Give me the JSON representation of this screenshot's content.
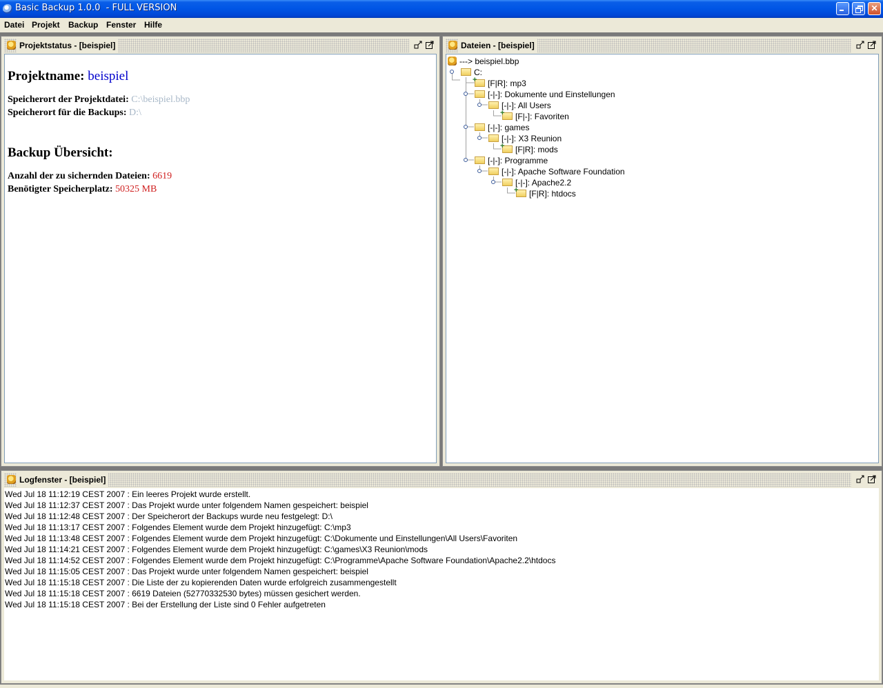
{
  "window": {
    "title": "Basic Backup 1.0.0  - FULL VERSION",
    "minimize_icon": "minimize-icon",
    "restore_icon": "restore-icon",
    "close_icon": "close-icon"
  },
  "menubar": {
    "items": [
      "Datei",
      "Projekt",
      "Backup",
      "Fenster",
      "Hilfe"
    ]
  },
  "status_panel": {
    "title": "Projektstatus - [beispiel]",
    "project_name_label": "Projektname:",
    "project_name_value": "beispiel",
    "file_location_label": "Speicherort der Projektdatei:",
    "file_location_value": "C:\\beispiel.bbp",
    "backup_location_label": "Speicherort für die Backups:",
    "backup_location_value": "D:\\",
    "overview_heading": "Backup Übersicht:",
    "file_count_label": "Anzahl der zu sichernden Dateien:",
    "file_count_value": "6619",
    "space_label": "Benötigter Speicherplatz:",
    "space_value": "50325 MB"
  },
  "files_panel": {
    "title": "Dateien - [beispiel]",
    "tree": [
      {
        "label": "---> beispiel.bbp"
      },
      {
        "label": "C:"
      },
      {
        "label": "[F|R]: mp3"
      },
      {
        "label": "[-|-]: Dokumente und Einstellungen"
      },
      {
        "label": "[-|-]: All Users"
      },
      {
        "label": "[F|-]: Favoriten"
      },
      {
        "label": "[-|-]: games"
      },
      {
        "label": "[-|-]: X3 Reunion"
      },
      {
        "label": "[F|R]: mods"
      },
      {
        "label": "[-|-]: Programme"
      },
      {
        "label": "[-|-]: Apache Software Foundation"
      },
      {
        "label": "[-|-]: Apache2.2"
      },
      {
        "label": "[F|R]: htdocs"
      }
    ]
  },
  "log_panel": {
    "title": "Logfenster - [beispiel]",
    "lines": [
      "Wed Jul 18 11:12:19 CEST 2007 : Ein leeres Projekt wurde erstellt.",
      "Wed Jul 18 11:12:37 CEST 2007 : Das Projekt wurde unter folgendem Namen gespeichert: beispiel",
      "Wed Jul 18 11:12:48 CEST 2007 : Der Speicherort der Backups wurde neu festgelegt: D:\\",
      "Wed Jul 18 11:13:17 CEST 2007 : Folgendes Element wurde dem Projekt hinzugefügt: C:\\mp3",
      "Wed Jul 18 11:13:48 CEST 2007 : Folgendes Element wurde dem Projekt hinzugefügt: C:\\Dokumente und Einstellungen\\All Users\\Favoriten",
      "Wed Jul 18 11:14:21 CEST 2007 : Folgendes Element wurde dem Projekt hinzugefügt: C:\\games\\X3 Reunion\\mods",
      "Wed Jul 18 11:14:52 CEST 2007 : Folgendes Element wurde dem Projekt hinzugefügt: C:\\Programme\\Apache Software Foundation\\Apache2.2\\htdocs",
      "Wed Jul 18 11:15:05 CEST 2007 : Das Projekt wurde unter folgendem Namen gespeichert: beispiel",
      "Wed Jul 18 11:15:18 CEST 2007 : Die Liste der zu kopierenden Daten wurde erfolgreich zusammengestellt",
      "Wed Jul 18 11:15:18 CEST 2007 : 6619 Dateien (52770332530 bytes) müssen gesichert werden.",
      "Wed Jul 18 11:15:18 CEST 2007 : Bei der Erstellung der Liste sind 0 Fehler aufgetreten"
    ]
  }
}
